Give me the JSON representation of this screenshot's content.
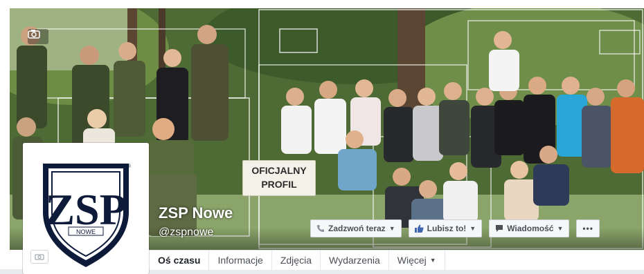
{
  "page": {
    "name": "ZSP Nowe",
    "handle": "@zspnowe"
  },
  "cover": {
    "stamp_line1": "OFICJALNY",
    "stamp_line2": "PROFIL"
  },
  "profile_picture": {
    "logo_letters": "ZSP",
    "logo_small": "NOWE"
  },
  "actions": {
    "call": {
      "label": "Zadzwoń teraz",
      "icon": "phone-icon"
    },
    "like": {
      "label": "Lubisz to!",
      "icon": "thumbs-up-icon"
    },
    "message": {
      "label": "Wiadomość",
      "icon": "message-icon"
    },
    "more": {
      "label": "•••",
      "icon": "more-icon"
    }
  },
  "tabs": [
    {
      "label": "Oś czasu",
      "active": true
    },
    {
      "label": "Informacje",
      "active": false
    },
    {
      "label": "Zdjęcia",
      "active": false
    },
    {
      "label": "Wydarzenia",
      "active": false
    },
    {
      "label": "Więcej",
      "active": false
    }
  ],
  "colors": {
    "facebook_blue": "#4267b2",
    "button_bg": "#f6f7f9",
    "text_dark": "#1d2129"
  }
}
